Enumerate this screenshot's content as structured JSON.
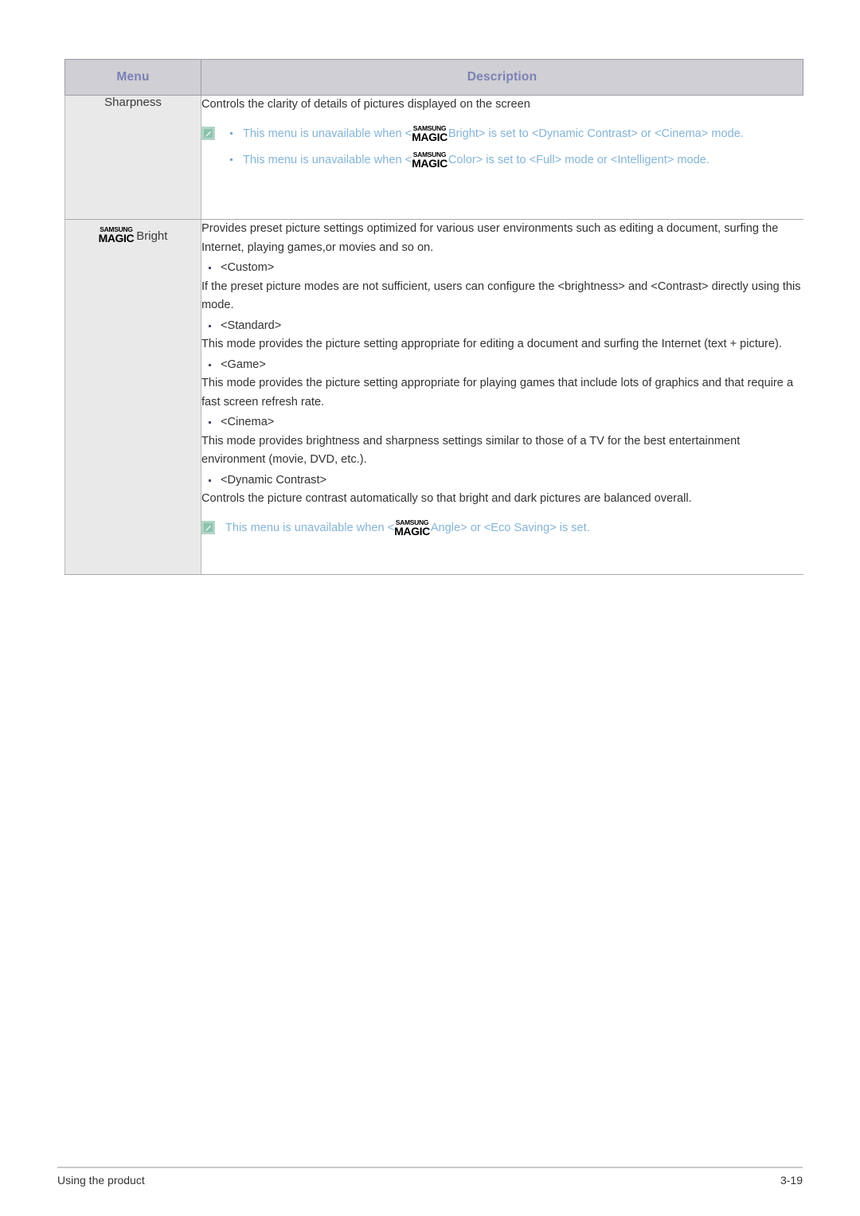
{
  "table": {
    "headers": {
      "menu": "Menu",
      "description": "Description"
    },
    "rows": [
      {
        "menu_label": "Sharpness",
        "intro": "Controls the clarity of details of pictures displayed on the screen",
        "notes": [
          {
            "pre": "This menu is unavailable when <",
            "logo_line1": "SAMSUNG",
            "logo_line2": "MAGIC",
            "post": "Bright> is set to <Dynamic Contrast> or <Cinema> mode."
          },
          {
            "pre": "This menu is unavailable when <",
            "logo_line1": "SAMSUNG",
            "logo_line2": "MAGIC",
            "post": "Color> is set to <Full> mode or <Intelligent> mode."
          }
        ]
      },
      {
        "menu_logo_line1": "SAMSUNG",
        "menu_logo_line2": "MAGIC",
        "menu_word": "Bright",
        "intro": "Provides preset picture settings optimized for various user environments such as editing a document, surfing the Internet, playing games,or movies and so on.",
        "modes": [
          {
            "bullet": "<Custom>",
            "body": "If the preset picture modes are not sufficient, users can configure the <brightness> and <Contrast> directly using this mode."
          },
          {
            "bullet": "<Standard>",
            "body": " This mode provides the picture setting appropriate for editing a document and surfing the Internet (text + picture)."
          },
          {
            "bullet": "<Game>",
            "body": "This mode provides the picture setting appropriate for playing games that include lots of graphics and that require a fast screen refresh rate."
          },
          {
            "bullet": "<Cinema>",
            "body": "This mode provides brightness and sharpness settings similar to those of a TV for the best entertainment environment (movie, DVD, etc.)."
          },
          {
            "bullet": "<Dynamic Contrast>",
            "body": "Controls the picture contrast automatically so that bright and dark pictures are balanced overall."
          }
        ],
        "note": {
          "pre": "This menu is unavailable when <",
          "logo_line1": "SAMSUNG",
          "logo_line2": "MAGIC",
          "post": "Angle> or <Eco Saving> is set."
        }
      }
    ]
  },
  "footer": {
    "left": "Using the product",
    "right": "3-19"
  },
  "colors": {
    "header_text": "#7c80b4",
    "header_bg": "#cfcfd4",
    "menu_cell_bg": "#e9e9e9",
    "note_text": "#84b4d6",
    "note_icon_bg": "#8cc3ae",
    "body_text": "#333333"
  },
  "icons": {
    "note": "note-pencil-icon"
  }
}
